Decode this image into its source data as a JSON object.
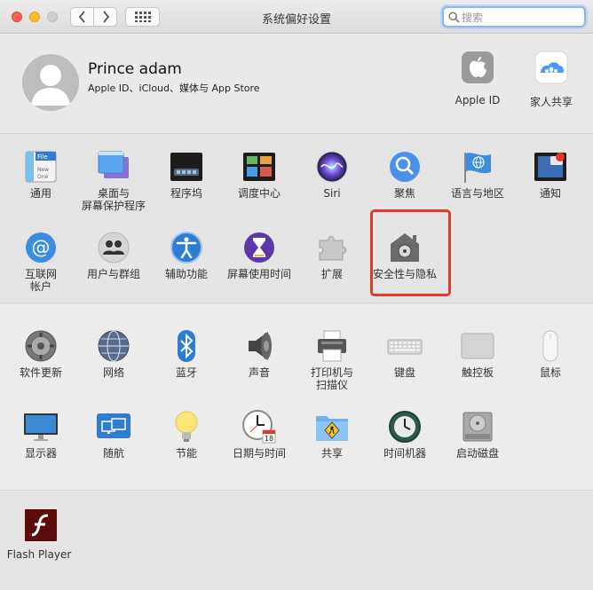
{
  "window": {
    "title": "系统偏好设置",
    "search_placeholder": "搜索"
  },
  "account": {
    "name": "Prince adam",
    "subtitle": "Apple ID、iCloud、媒体与 App Store",
    "items": [
      {
        "label": "Apple ID",
        "icon": "apple-icon"
      },
      {
        "label": "家人共享",
        "icon": "family-sharing-icon"
      }
    ]
  },
  "personal": [
    {
      "label": "通用",
      "icon": "general-icon"
    },
    {
      "label": "桌面与\n屏幕保护程序",
      "icon": "desktop-screensaver-icon"
    },
    {
      "label": "程序坞",
      "icon": "dock-icon"
    },
    {
      "label": "调度中心",
      "icon": "mission-control-icon"
    },
    {
      "label": "Siri",
      "icon": "siri-icon"
    },
    {
      "label": "聚焦",
      "icon": "spotlight-icon"
    },
    {
      "label": "语言与地区",
      "icon": "language-region-icon"
    },
    {
      "label": "通知",
      "icon": "notifications-icon"
    },
    {
      "label": "互联网\n帐户",
      "icon": "internet-accounts-icon"
    },
    {
      "label": "用户与群组",
      "icon": "users-groups-icon"
    },
    {
      "label": "辅助功能",
      "icon": "accessibility-icon"
    },
    {
      "label": "屏幕使用时间",
      "icon": "screen-time-icon"
    },
    {
      "label": "扩展",
      "icon": "extensions-icon"
    },
    {
      "label": "安全性与隐私",
      "icon": "security-privacy-icon"
    }
  ],
  "hardware": [
    {
      "label": "软件更新",
      "icon": "software-update-icon"
    },
    {
      "label": "网络",
      "icon": "network-icon"
    },
    {
      "label": "蓝牙",
      "icon": "bluetooth-icon"
    },
    {
      "label": "声音",
      "icon": "sound-icon"
    },
    {
      "label": "打印机与\n扫描仪",
      "icon": "printer-scanner-icon"
    },
    {
      "label": "键盘",
      "icon": "keyboard-icon"
    },
    {
      "label": "触控板",
      "icon": "trackpad-icon"
    },
    {
      "label": "鼠标",
      "icon": "mouse-icon"
    },
    {
      "label": "显示器",
      "icon": "displays-icon"
    },
    {
      "label": "随航",
      "icon": "sidecar-icon"
    },
    {
      "label": "节能",
      "icon": "energy-saver-icon"
    },
    {
      "label": "日期与时间",
      "icon": "date-time-icon"
    },
    {
      "label": "共享",
      "icon": "sharing-icon"
    },
    {
      "label": "时间机器",
      "icon": "time-machine-icon"
    },
    {
      "label": "启动磁盘",
      "icon": "startup-disk-icon"
    }
  ],
  "other": [
    {
      "label": "Flash Player",
      "icon": "flash-player-icon"
    }
  ],
  "colors": {
    "highlight": "#e5372a",
    "search_focus": "#8db3f0"
  }
}
